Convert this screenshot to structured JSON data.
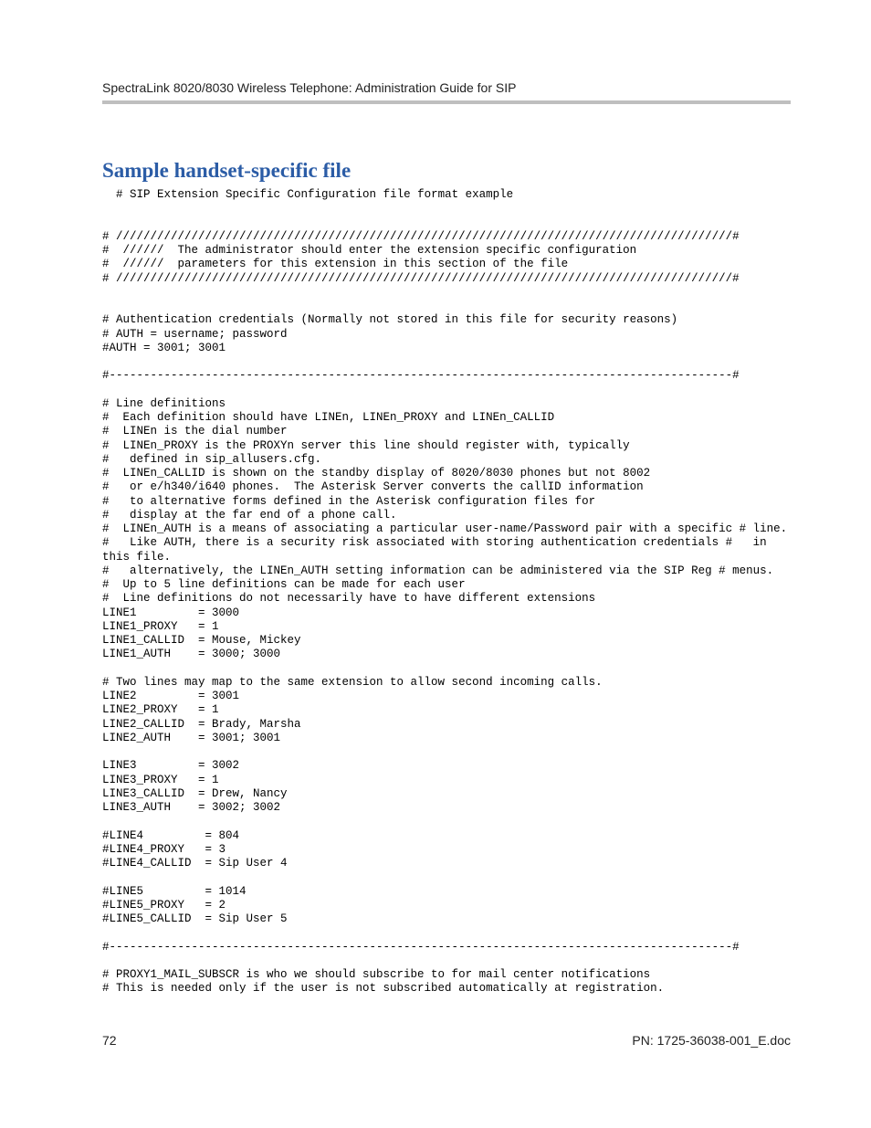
{
  "header": {
    "text": "SpectraLink 8020/8030 Wireless Telephone: Administration Guide for SIP"
  },
  "section": {
    "title": "Sample handset-specific file"
  },
  "code": "  # SIP Extension Specific Configuration file format example\n\n\n# //////////////////////////////////////////////////////////////////////////////////////////#\n#  //////  The administrator should enter the extension specific configuration\n#  //////  parameters for this extension in this section of the file\n# //////////////////////////////////////////////////////////////////////////////////////////#\n\n\n# Authentication credentials (Normally not stored in this file for security reasons)\n# AUTH = username; password\n#AUTH = 3001; 3001\n\n#-------------------------------------------------------------------------------------------#\n\n# Line definitions\n#  Each definition should have LINEn, LINEn_PROXY and LINEn_CALLID\n#  LINEn is the dial number\n#  LINEn_PROXY is the PROXYn server this line should register with, typically\n#   defined in sip_allusers.cfg.\n#  LINEn_CALLID is shown on the standby display of 8020/8030 phones but not 8002\n#   or e/h340/i640 phones.  The Asterisk Server converts the callID information\n#   to alternative forms defined in the Asterisk configuration files for\n#   display at the far end of a phone call.\n#  LINEn_AUTH is a means of associating a particular user-name/Password pair with a specific # line.\n#   Like AUTH, there is a security risk associated with storing authentication credentials #   in this file.\n#   alternatively, the LINEn_AUTH setting information can be administered via the SIP Reg # menus.\n#  Up to 5 line definitions can be made for each user\n#  Line definitions do not necessarily have to have different extensions\nLINE1         = 3000\nLINE1_PROXY   = 1\nLINE1_CALLID  = Mouse, Mickey\nLINE1_AUTH    = 3000; 3000\n\n# Two lines may map to the same extension to allow second incoming calls.\nLINE2         = 3001\nLINE2_PROXY   = 1\nLINE2_CALLID  = Brady, Marsha\nLINE2_AUTH    = 3001; 3001\n\nLINE3         = 3002\nLINE3_PROXY   = 1\nLINE3_CALLID  = Drew, Nancy\nLINE3_AUTH    = 3002; 3002\n\n#LINE4         = 804\n#LINE4_PROXY   = 3\n#LINE4_CALLID  = Sip User 4\n\n#LINE5         = 1014\n#LINE5_PROXY   = 2\n#LINE5_CALLID  = Sip User 5\n\n#-------------------------------------------------------------------------------------------#\n\n# PROXY1_MAIL_SUBSCR is who we should subscribe to for mail center notifications\n# This is needed only if the user is not subscribed automatically at registration.",
  "footer": {
    "page_number": "72",
    "doc_id": "PN: 1725-36038-001_E.doc"
  }
}
